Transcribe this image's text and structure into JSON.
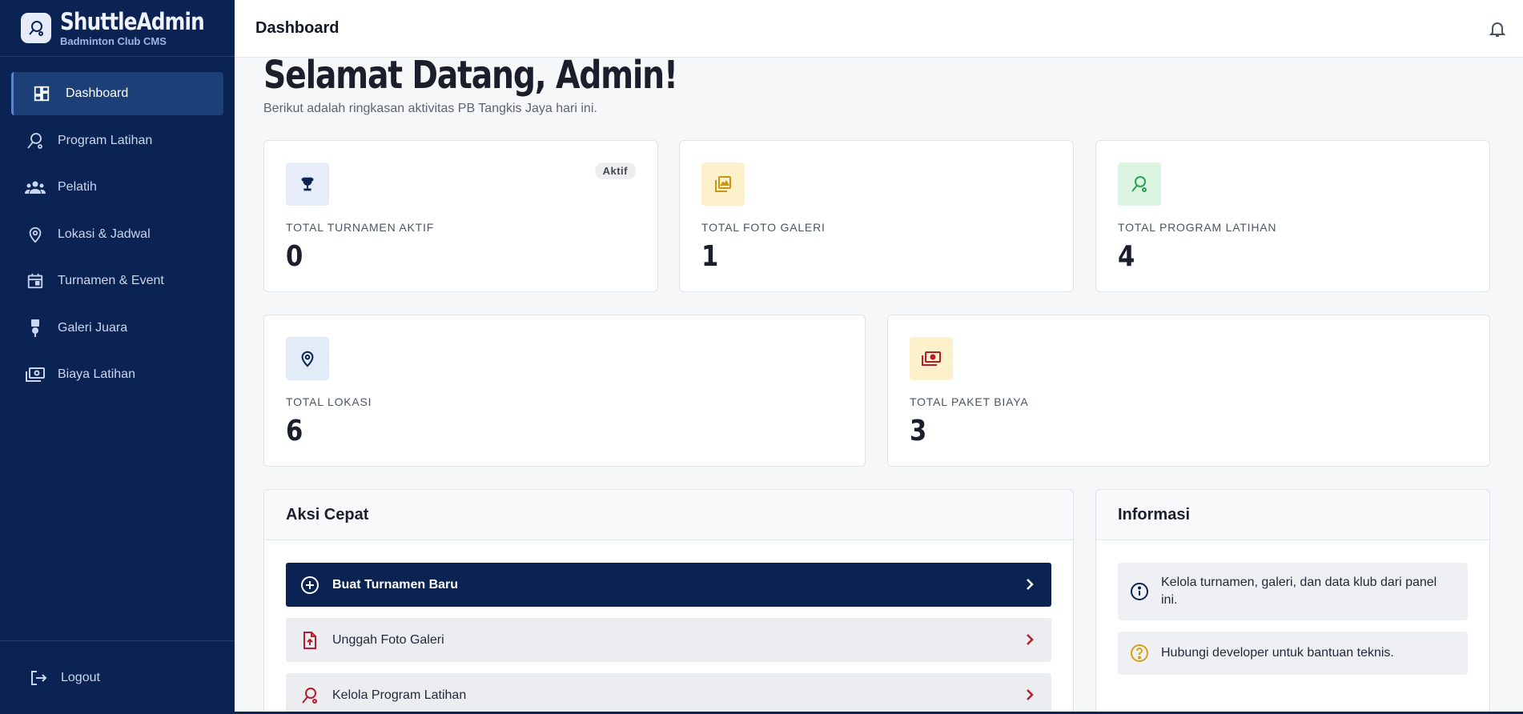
{
  "brand": {
    "name": "ShuttleAdmin",
    "tagline": "Badminton Club CMS"
  },
  "sidebar": {
    "items": [
      {
        "label": "Dashboard",
        "icon": "dashboard-icon",
        "active": true
      },
      {
        "label": "Program Latihan",
        "icon": "racket-icon"
      },
      {
        "label": "Pelatih",
        "icon": "group-icon"
      },
      {
        "label": "Lokasi & Jadwal",
        "icon": "location-pin-icon"
      },
      {
        "label": "Turnamen & Event",
        "icon": "calendar-icon"
      },
      {
        "label": "Galeri Juara",
        "icon": "medal-icon"
      },
      {
        "label": "Biaya Latihan",
        "icon": "money-icon"
      }
    ],
    "logout_label": "Logout"
  },
  "header": {
    "title": "Dashboard",
    "bell_icon": "bell-icon"
  },
  "welcome": {
    "title": "Selamat Datang, Admin!",
    "subtitle": "Berikut adalah ringkasan aktivitas PB Tangkis Jaya hari ini."
  },
  "stats": [
    {
      "label": "TOTAL TURNAMEN AKTIF",
      "value": "0",
      "badge": "Aktif",
      "icon": "trophy-icon",
      "color": "#e6edf8"
    },
    {
      "label": "TOTAL FOTO GALERI",
      "value": "1",
      "icon": "gallery-icon",
      "color": "#fdf1cc"
    },
    {
      "label": "TOTAL PROGRAM LATIHAN",
      "value": "4",
      "icon": "racket-icon",
      "color": "#dcf5e3"
    },
    {
      "label": "TOTAL LOKASI",
      "value": "6",
      "icon": "location-pin-icon",
      "color": "#e2ebf8"
    },
    {
      "label": "TOTAL PAKET BIAYA",
      "value": "3",
      "icon": "money-icon",
      "color": "#fdf1cc"
    }
  ],
  "quick_actions": {
    "title": "Aksi Cepat",
    "items": [
      {
        "label": "Buat Turnamen Baru",
        "icon": "plus-circle-icon",
        "primary": true
      },
      {
        "label": "Unggah Foto Galeri",
        "icon": "upload-file-icon"
      },
      {
        "label": "Kelola Program Latihan",
        "icon": "racket-icon"
      }
    ]
  },
  "info": {
    "title": "Informasi",
    "items": [
      {
        "text": "Kelola turnamen, galeri, dan data klub dari panel ini.",
        "icon": "info-icon"
      },
      {
        "text": "Hubungi developer untuk bantuan teknis.",
        "icon": "help-icon"
      }
    ]
  },
  "colors": {
    "sidebar_bg": "#0b2353",
    "accent_red": "#b91c2c",
    "accent_gold": "#d4a017",
    "accent_green": "#2e9e4f"
  }
}
